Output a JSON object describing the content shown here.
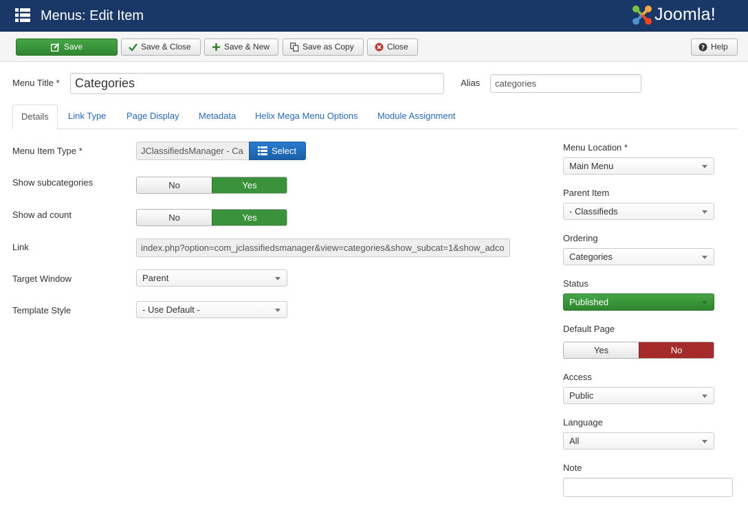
{
  "header": {
    "title": "Menus: Edit Item",
    "brand": "Joomla!"
  },
  "toolbar": {
    "save": "Save",
    "save_close": "Save & Close",
    "save_new": "Save & New",
    "save_copy": "Save as Copy",
    "close": "Close",
    "help": "Help"
  },
  "form": {
    "menu_title_label": "Menu Title *",
    "menu_title_value": "Categories",
    "alias_label": "Alias",
    "alias_value": "categories"
  },
  "tabs": [
    "Details",
    "Link Type",
    "Page Display",
    "Metadata",
    "Helix Mega Menu Options",
    "Module Assignment"
  ],
  "details": {
    "menu_item_type_label": "Menu Item Type *",
    "menu_item_type_value": "JClassifiedsManager - Ca",
    "select_button": "Select",
    "show_subcategories_label": "Show subcategories",
    "show_subcategories": {
      "no": "No",
      "yes": "Yes",
      "selected": "Yes"
    },
    "show_ad_count_label": "Show ad count",
    "show_ad_count": {
      "no": "No",
      "yes": "Yes",
      "selected": "Yes"
    },
    "link_label": "Link",
    "link_value": "index.php?option=com_jclassifiedsmanager&view=categories&show_subcat=1&show_adco",
    "target_window_label": "Target Window",
    "target_window_value": "Parent",
    "template_style_label": "Template Style",
    "template_style_value": "- Use Default -"
  },
  "sidebar": {
    "menu_location_label": "Menu Location *",
    "menu_location_value": "Main Menu",
    "parent_item_label": "Parent Item",
    "parent_item_value": "- Classifieds",
    "ordering_label": "Ordering",
    "ordering_value": "Categories",
    "status_label": "Status",
    "status_value": "Published",
    "default_page_label": "Default Page",
    "default_page": {
      "yes": "Yes",
      "no": "No",
      "selected": "No"
    },
    "access_label": "Access",
    "access_value": "Public",
    "language_label": "Language",
    "language_value": "All",
    "note_label": "Note",
    "note_value": ""
  },
  "colors": {
    "header_bg": "#1a3867",
    "save_green": "#3a933a",
    "select_blue": "#2a69b8",
    "no_red": "#a52b2b"
  }
}
